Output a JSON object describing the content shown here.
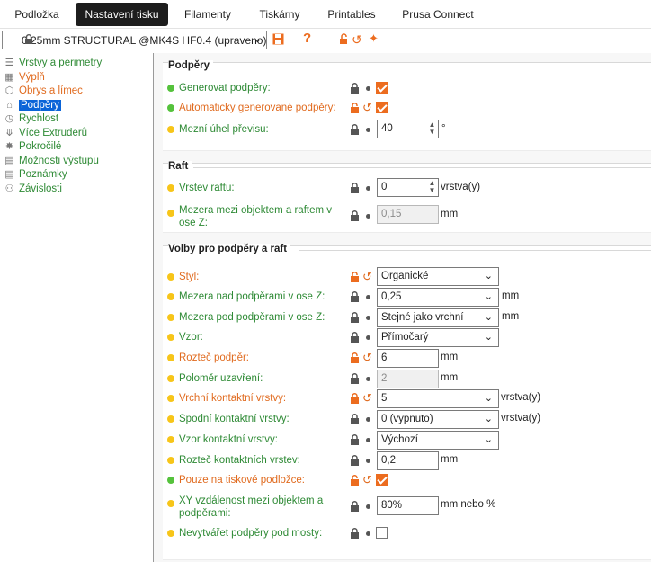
{
  "tabs": [
    {
      "label": "Podložka",
      "active": false
    },
    {
      "label": "Nastavení tisku",
      "active": true
    },
    {
      "label": "Filamenty",
      "active": false
    },
    {
      "label": "Tiskárny",
      "active": false
    },
    {
      "label": "Printables",
      "active": false
    },
    {
      "label": "Prusa Connect",
      "active": false
    }
  ],
  "preset": {
    "name": "0.25mm STRUCTURAL @MK4S HF0.4 (upraveno)",
    "help_glyph": "?"
  },
  "sidebar": {
    "items": [
      {
        "label": "Vrstvy a perimetry",
        "color": "green",
        "icon": "layers-icon"
      },
      {
        "label": "Výplň",
        "color": "orange",
        "icon": "infill-icon"
      },
      {
        "label": "Obrys a límec",
        "color": "orange",
        "icon": "skirt-icon"
      },
      {
        "label": "Podpěry",
        "color": "selected",
        "icon": "support-icon"
      },
      {
        "label": "Rychlost",
        "color": "green",
        "icon": "speed-icon"
      },
      {
        "label": "Více Extruderů",
        "color": "green",
        "icon": "extruders-icon"
      },
      {
        "label": "Pokročilé",
        "color": "green",
        "icon": "advanced-icon"
      },
      {
        "label": "Možnosti výstupu",
        "color": "green",
        "icon": "output-icon"
      },
      {
        "label": "Poznámky",
        "color": "green",
        "icon": "notes-icon"
      },
      {
        "label": "Závislosti",
        "color": "green",
        "icon": "dependencies-icon"
      }
    ]
  },
  "groups": {
    "supports": {
      "title": "Podpěry",
      "rows": [
        {
          "label": "Generovat podpěry:",
          "dot": "green",
          "label_color": "green",
          "lock": "locked",
          "control": "checkbox",
          "checked": true
        },
        {
          "label": "Automaticky generované podpěry:",
          "dot": "green",
          "label_color": "orange",
          "lock": "unlocked",
          "control": "checkbox",
          "checked": true
        },
        {
          "label": "Mezní úhel převisu:",
          "dot": "yellow",
          "label_color": "green",
          "lock": "locked",
          "control": "spin",
          "value": "40",
          "unit": "°"
        }
      ]
    },
    "raft": {
      "title": "Raft",
      "rows": [
        {
          "label": "Vrstev raftu:",
          "dot": "yellow",
          "label_color": "green",
          "lock": "locked",
          "control": "spin",
          "value": "0",
          "unit": "vrstva(y)"
        },
        {
          "label": "Mezera mezi objektem a raftem v ose Z:",
          "dot": "yellow",
          "label_color": "green",
          "lock": "locked",
          "control": "text-disabled",
          "value": "0,15",
          "unit": "mm"
        }
      ]
    },
    "options": {
      "title": "Volby pro podpěry a raft",
      "rows": [
        {
          "label": "Styl:",
          "dot": "yellow",
          "label_color": "orange",
          "lock": "unlocked",
          "control": "combo",
          "value": "Organické",
          "unit": ""
        },
        {
          "label": "Mezera nad podpěrami v ose Z:",
          "dot": "yellow",
          "label_color": "green",
          "lock": "locked",
          "control": "combo",
          "value": "0,25",
          "unit": "mm"
        },
        {
          "label": "Mezera pod podpěrami v ose Z:",
          "dot": "yellow",
          "label_color": "green",
          "lock": "locked",
          "control": "combo",
          "value": "Stejné jako vrchní",
          "unit": "mm"
        },
        {
          "label": "Vzor:",
          "dot": "yellow",
          "label_color": "green",
          "lock": "locked",
          "control": "combo",
          "value": "Přímočarý",
          "unit": ""
        },
        {
          "label": "Rozteč podpěr:",
          "dot": "yellow",
          "label_color": "orange",
          "lock": "unlocked",
          "control": "text",
          "value": "6",
          "unit": "mm"
        },
        {
          "label": "Poloměr uzavření:",
          "dot": "yellow",
          "label_color": "green",
          "lock": "locked",
          "control": "text-disabled",
          "value": "2",
          "unit": "mm"
        },
        {
          "label": "Vrchní kontaktní vrstvy:",
          "dot": "yellow",
          "label_color": "orange",
          "lock": "unlocked",
          "control": "combo",
          "value": "5",
          "unit": "vrstva(y)"
        },
        {
          "label": "Spodní kontaktní vrstvy:",
          "dot": "yellow",
          "label_color": "green",
          "lock": "locked",
          "control": "combo",
          "value": "0 (vypnuto)",
          "unit": "vrstva(y)"
        },
        {
          "label": "Vzor kontaktní vrstvy:",
          "dot": "yellow",
          "label_color": "green",
          "lock": "locked",
          "control": "combo",
          "value": "Výchozí",
          "unit": ""
        },
        {
          "label": "Rozteč kontaktních vrstev:",
          "dot": "yellow",
          "label_color": "green",
          "lock": "locked",
          "control": "text",
          "value": "0,2",
          "unit": "mm"
        },
        {
          "label": "Pouze na tiskové podložce:",
          "dot": "green",
          "label_color": "orange",
          "lock": "unlocked",
          "control": "checkbox",
          "checked": true
        },
        {
          "label": "XY vzdálenost mezi objektem a podpěrami:",
          "dot": "yellow",
          "label_color": "green",
          "lock": "locked",
          "control": "text",
          "value": "80%",
          "unit": "mm nebo %"
        },
        {
          "label": "Nevytvářet podpěry pod mosty:",
          "dot": "yellow",
          "label_color": "green",
          "lock": "locked",
          "control": "checkbox",
          "checked": false
        }
      ]
    }
  },
  "colors": {
    "accent_orange": "#ec6c1f",
    "label_green": "#2e8a35",
    "selection_blue": "#0a64d8"
  }
}
